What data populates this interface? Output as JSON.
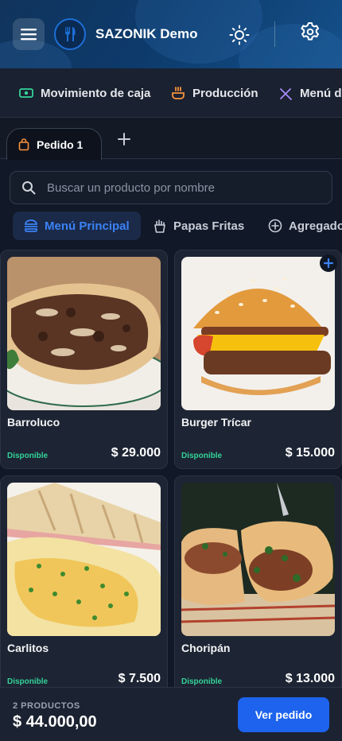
{
  "header": {
    "brand": "SAZONIK Demo",
    "accent": "#1d63ed"
  },
  "nav": {
    "items": [
      {
        "label": "Movimiento de caja",
        "icon": "cash-icon"
      },
      {
        "label": "Producción",
        "icon": "cooking-pot-icon"
      },
      {
        "label": "Menú de",
        "icon": "utensils-icon"
      }
    ]
  },
  "orders": {
    "tabs": [
      {
        "label": "Pedido 1",
        "icon": "shopping-bag-icon"
      }
    ]
  },
  "search": {
    "placeholder": "Buscar un producto por nombre"
  },
  "categories": [
    {
      "label": "Menú Principal",
      "icon": "burger-icon",
      "active": true
    },
    {
      "label": "Papas Fritas",
      "icon": "fries-icon",
      "active": false
    },
    {
      "label": "Agregado",
      "icon": "plus-circle-icon",
      "active": false
    }
  ],
  "products": [
    {
      "name": "Barroluco",
      "status": "Disponible",
      "price": "$ 29.000"
    },
    {
      "name": "Burger Trícar",
      "status": "Disponible",
      "price": "$ 15.000"
    },
    {
      "name": "Carlitos",
      "status": "Disponible",
      "price": "$ 7.500"
    },
    {
      "name": "Choripán",
      "status": "Disponible",
      "price": "$ 13.000"
    }
  ],
  "cart": {
    "count_label": "2 PRODUCTOS",
    "total": "$ 44.000,00",
    "button_label": "Ver pedido"
  }
}
